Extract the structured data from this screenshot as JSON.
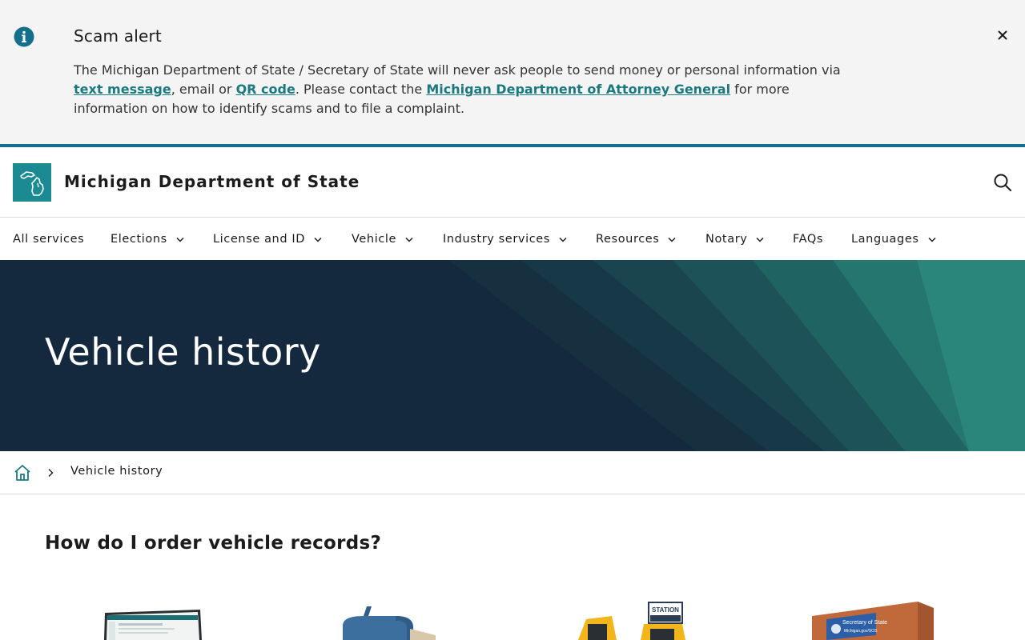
{
  "alert": {
    "title": "Scam alert",
    "text_1": "The Michigan Department of State / Secretary of State will never ask people to send money or personal information via ",
    "link_text_message": "text message",
    "text_2": ", email or ",
    "link_qr_code": "QR code",
    "text_3": ". Please contact the ",
    "link_attorney_general": "Michigan Department of Attorney General",
    "text_4": " for more information on how to identify scams and to file a complaint."
  },
  "header": {
    "site_title": "Michigan Department of State"
  },
  "nav": {
    "items": [
      {
        "label": "All services",
        "has_dropdown": false
      },
      {
        "label": "Elections",
        "has_dropdown": true
      },
      {
        "label": "License and ID",
        "has_dropdown": true
      },
      {
        "label": "Vehicle",
        "has_dropdown": true
      },
      {
        "label": "Industry services",
        "has_dropdown": true
      },
      {
        "label": "Resources",
        "has_dropdown": true
      },
      {
        "label": "Notary",
        "has_dropdown": true
      },
      {
        "label": "FAQs",
        "has_dropdown": false
      },
      {
        "label": "Languages",
        "has_dropdown": true
      }
    ]
  },
  "hero": {
    "title": "Vehicle history"
  },
  "breadcrumb": {
    "current": "Vehicle history"
  },
  "main": {
    "section_title": "How do I order vehicle records?",
    "cards": [
      {
        "icon": "computer-screen-image"
      },
      {
        "icon": "mailbox-image"
      },
      {
        "icon": "self-service-station-image",
        "sign_text": "STATION"
      },
      {
        "icon": "sos-office-building-image",
        "sign_text": "Secretary of State",
        "sign_subtext": "Michigan.gov/SOS"
      }
    ]
  },
  "colors": {
    "alert_bg": "#f4f4f4",
    "accent_teal": "#1a7a80",
    "top_line": "#136f8c",
    "hero_bg": "#14293d",
    "logo_bg": "#1c8a92"
  }
}
